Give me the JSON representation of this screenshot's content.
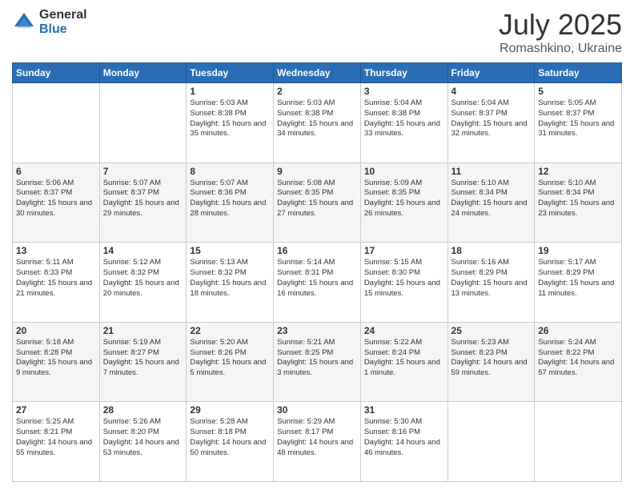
{
  "logo": {
    "general": "General",
    "blue": "Blue"
  },
  "title": {
    "month": "July 2025",
    "location": "Romashkino, Ukraine"
  },
  "weekdays": [
    "Sunday",
    "Monday",
    "Tuesday",
    "Wednesday",
    "Thursday",
    "Friday",
    "Saturday"
  ],
  "weeks": [
    [
      {
        "day": "",
        "info": ""
      },
      {
        "day": "",
        "info": ""
      },
      {
        "day": "1",
        "info": "Sunrise: 5:03 AM\nSunset: 8:38 PM\nDaylight: 15 hours and 35 minutes."
      },
      {
        "day": "2",
        "info": "Sunrise: 5:03 AM\nSunset: 8:38 PM\nDaylight: 15 hours and 34 minutes."
      },
      {
        "day": "3",
        "info": "Sunrise: 5:04 AM\nSunset: 8:38 PM\nDaylight: 15 hours and 33 minutes."
      },
      {
        "day": "4",
        "info": "Sunrise: 5:04 AM\nSunset: 8:37 PM\nDaylight: 15 hours and 32 minutes."
      },
      {
        "day": "5",
        "info": "Sunrise: 5:05 AM\nSunset: 8:37 PM\nDaylight: 15 hours and 31 minutes."
      }
    ],
    [
      {
        "day": "6",
        "info": "Sunrise: 5:06 AM\nSunset: 8:37 PM\nDaylight: 15 hours and 30 minutes."
      },
      {
        "day": "7",
        "info": "Sunrise: 5:07 AM\nSunset: 8:37 PM\nDaylight: 15 hours and 29 minutes."
      },
      {
        "day": "8",
        "info": "Sunrise: 5:07 AM\nSunset: 8:36 PM\nDaylight: 15 hours and 28 minutes."
      },
      {
        "day": "9",
        "info": "Sunrise: 5:08 AM\nSunset: 8:35 PM\nDaylight: 15 hours and 27 minutes."
      },
      {
        "day": "10",
        "info": "Sunrise: 5:09 AM\nSunset: 8:35 PM\nDaylight: 15 hours and 26 minutes."
      },
      {
        "day": "11",
        "info": "Sunrise: 5:10 AM\nSunset: 8:34 PM\nDaylight: 15 hours and 24 minutes."
      },
      {
        "day": "12",
        "info": "Sunrise: 5:10 AM\nSunset: 8:34 PM\nDaylight: 15 hours and 23 minutes."
      }
    ],
    [
      {
        "day": "13",
        "info": "Sunrise: 5:11 AM\nSunset: 8:33 PM\nDaylight: 15 hours and 21 minutes."
      },
      {
        "day": "14",
        "info": "Sunrise: 5:12 AM\nSunset: 8:32 PM\nDaylight: 15 hours and 20 minutes."
      },
      {
        "day": "15",
        "info": "Sunrise: 5:13 AM\nSunset: 8:32 PM\nDaylight: 15 hours and 18 minutes."
      },
      {
        "day": "16",
        "info": "Sunrise: 5:14 AM\nSunset: 8:31 PM\nDaylight: 15 hours and 16 minutes."
      },
      {
        "day": "17",
        "info": "Sunrise: 5:15 AM\nSunset: 8:30 PM\nDaylight: 15 hours and 15 minutes."
      },
      {
        "day": "18",
        "info": "Sunrise: 5:16 AM\nSunset: 8:29 PM\nDaylight: 15 hours and 13 minutes."
      },
      {
        "day": "19",
        "info": "Sunrise: 5:17 AM\nSunset: 8:29 PM\nDaylight: 15 hours and 11 minutes."
      }
    ],
    [
      {
        "day": "20",
        "info": "Sunrise: 5:18 AM\nSunset: 8:28 PM\nDaylight: 15 hours and 9 minutes."
      },
      {
        "day": "21",
        "info": "Sunrise: 5:19 AM\nSunset: 8:27 PM\nDaylight: 15 hours and 7 minutes."
      },
      {
        "day": "22",
        "info": "Sunrise: 5:20 AM\nSunset: 8:26 PM\nDaylight: 15 hours and 5 minutes."
      },
      {
        "day": "23",
        "info": "Sunrise: 5:21 AM\nSunset: 8:25 PM\nDaylight: 15 hours and 3 minutes."
      },
      {
        "day": "24",
        "info": "Sunrise: 5:22 AM\nSunset: 8:24 PM\nDaylight: 15 hours and 1 minute."
      },
      {
        "day": "25",
        "info": "Sunrise: 5:23 AM\nSunset: 8:23 PM\nDaylight: 14 hours and 59 minutes."
      },
      {
        "day": "26",
        "info": "Sunrise: 5:24 AM\nSunset: 8:22 PM\nDaylight: 14 hours and 57 minutes."
      }
    ],
    [
      {
        "day": "27",
        "info": "Sunrise: 5:25 AM\nSunset: 8:21 PM\nDaylight: 14 hours and 55 minutes."
      },
      {
        "day": "28",
        "info": "Sunrise: 5:26 AM\nSunset: 8:20 PM\nDaylight: 14 hours and 53 minutes."
      },
      {
        "day": "29",
        "info": "Sunrise: 5:28 AM\nSunset: 8:18 PM\nDaylight: 14 hours and 50 minutes."
      },
      {
        "day": "30",
        "info": "Sunrise: 5:29 AM\nSunset: 8:17 PM\nDaylight: 14 hours and 48 minutes."
      },
      {
        "day": "31",
        "info": "Sunrise: 5:30 AM\nSunset: 8:16 PM\nDaylight: 14 hours and 46 minutes."
      },
      {
        "day": "",
        "info": ""
      },
      {
        "day": "",
        "info": ""
      }
    ]
  ]
}
